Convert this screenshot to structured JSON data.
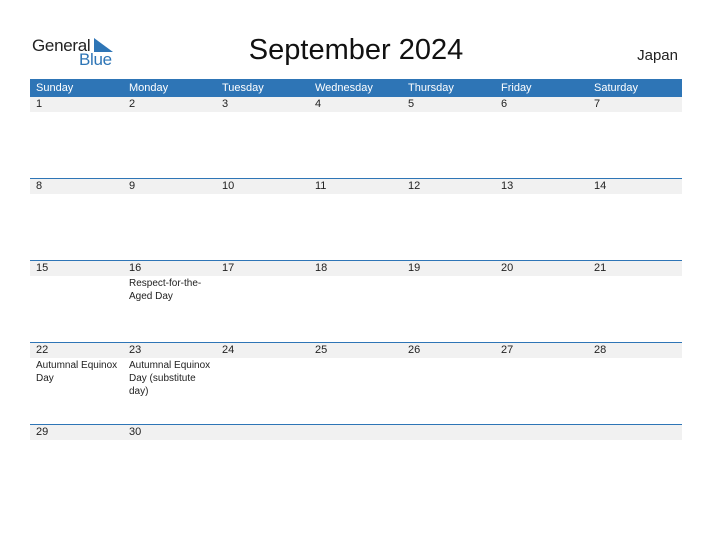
{
  "logo": {
    "word1": "General",
    "word2": "Blue",
    "brand_color": "#2e75b6"
  },
  "title": "September 2024",
  "country": "Japan",
  "colors": {
    "header_bg": "#2e75b6",
    "day_strip": "#f1f1f1"
  },
  "weekdays": [
    "Sunday",
    "Monday",
    "Tuesday",
    "Wednesday",
    "Thursday",
    "Friday",
    "Saturday"
  ],
  "weeks": [
    [
      {
        "day": "1",
        "holiday": ""
      },
      {
        "day": "2",
        "holiday": ""
      },
      {
        "day": "3",
        "holiday": ""
      },
      {
        "day": "4",
        "holiday": ""
      },
      {
        "day": "5",
        "holiday": ""
      },
      {
        "day": "6",
        "holiday": ""
      },
      {
        "day": "7",
        "holiday": ""
      }
    ],
    [
      {
        "day": "8",
        "holiday": ""
      },
      {
        "day": "9",
        "holiday": ""
      },
      {
        "day": "10",
        "holiday": ""
      },
      {
        "day": "11",
        "holiday": ""
      },
      {
        "day": "12",
        "holiday": ""
      },
      {
        "day": "13",
        "holiday": ""
      },
      {
        "day": "14",
        "holiday": ""
      }
    ],
    [
      {
        "day": "15",
        "holiday": ""
      },
      {
        "day": "16",
        "holiday": "Respect-for-the-Aged Day"
      },
      {
        "day": "17",
        "holiday": ""
      },
      {
        "day": "18",
        "holiday": ""
      },
      {
        "day": "19",
        "holiday": ""
      },
      {
        "day": "20",
        "holiday": ""
      },
      {
        "day": "21",
        "holiday": ""
      }
    ],
    [
      {
        "day": "22",
        "holiday": "Autumnal Equinox Day"
      },
      {
        "day": "23",
        "holiday": "Autumnal Equinox Day (substitute day)"
      },
      {
        "day": "24",
        "holiday": ""
      },
      {
        "day": "25",
        "holiday": ""
      },
      {
        "day": "26",
        "holiday": ""
      },
      {
        "day": "27",
        "holiday": ""
      },
      {
        "day": "28",
        "holiday": ""
      }
    ],
    [
      {
        "day": "29",
        "holiday": ""
      },
      {
        "day": "30",
        "holiday": ""
      },
      {
        "day": "",
        "holiday": ""
      },
      {
        "day": "",
        "holiday": ""
      },
      {
        "day": "",
        "holiday": ""
      },
      {
        "day": "",
        "holiday": ""
      },
      {
        "day": "",
        "holiday": ""
      }
    ]
  ]
}
